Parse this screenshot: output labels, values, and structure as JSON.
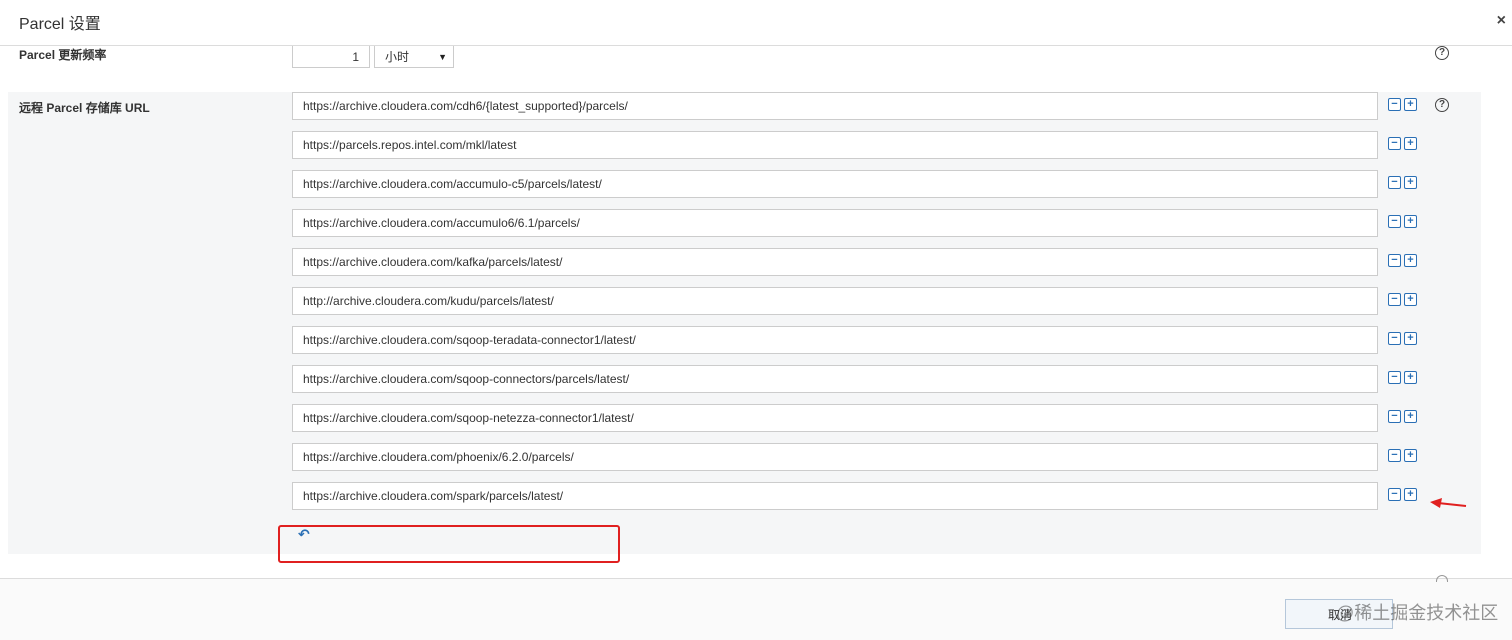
{
  "dialog": {
    "title": "Parcel 设置",
    "close_glyph": "×"
  },
  "update_frequency": {
    "label": "Parcel 更新频率",
    "value": "1",
    "unit_selected": "小时",
    "help_glyph": "?"
  },
  "remote_repos": {
    "label": "远程 Parcel 存储库 URL",
    "help_glyph": "?",
    "urls": [
      "https://archive.cloudera.com/cdh6/{latest_supported}/parcels/",
      "https://parcels.repos.intel.com/mkl/latest",
      "https://archive.cloudera.com/accumulo-c5/parcels/latest/",
      "https://archive.cloudera.com/accumulo6/6.1/parcels/",
      "https://archive.cloudera.com/kafka/parcels/latest/",
      "http://archive.cloudera.com/kudu/parcels/latest/",
      "https://archive.cloudera.com/sqoop-teradata-connector1/latest/",
      "https://archive.cloudera.com/sqoop-connectors/parcels/latest/",
      "https://archive.cloudera.com/sqoop-netezza-connector1/latest/",
      "https://archive.cloudera.com/phoenix/6.2.0/parcels/",
      "https://archive.cloudera.com/spark/parcels/latest/"
    ],
    "remove_glyph": "−",
    "add_glyph": "+",
    "undo_glyph": "↶"
  },
  "footer": {
    "cancel_label": "取消",
    "watermark": "@稀土掘金技术社区"
  },
  "colors": {
    "accent": "#2a6fb5",
    "highlight": "#e02020",
    "panel_bg": "#f5f6f7"
  }
}
